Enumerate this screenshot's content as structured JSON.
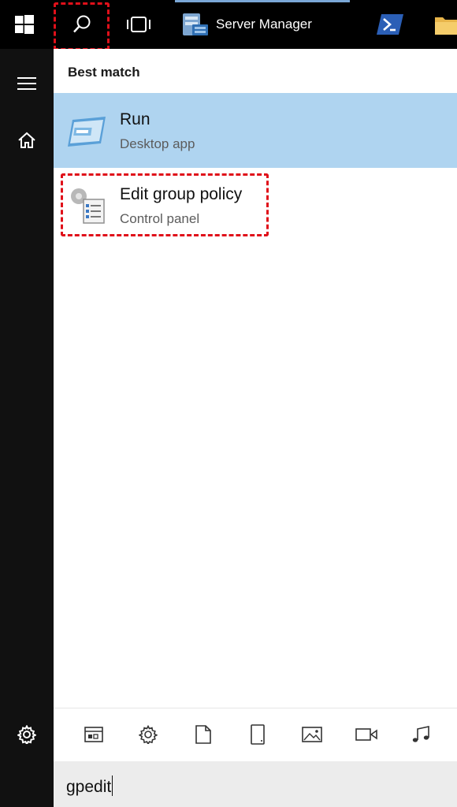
{
  "taskbar": {
    "apps": [
      {
        "label": "Server Manager",
        "icon": "server-manager-icon",
        "active": true
      },
      {
        "label": "",
        "icon": "powershell-icon"
      },
      {
        "label": "",
        "icon": "file-explorer-icon"
      }
    ]
  },
  "panel": {
    "section_title": "Best match",
    "results": [
      {
        "title": "Run",
        "subtitle": "Desktop app",
        "icon": "run-icon",
        "selected": true
      },
      {
        "title": "Edit group policy",
        "subtitle": "Control panel",
        "icon": "group-policy-icon",
        "selected": false
      }
    ]
  },
  "filters": [
    "apps-filter-icon",
    "settings-filter-icon",
    "documents-filter-icon",
    "tablet-filter-icon",
    "photos-filter-icon",
    "videos-filter-icon",
    "music-filter-icon"
  ],
  "search": {
    "value": "gpedit"
  },
  "colors": {
    "selected": "#afd4f0",
    "highlight": "#e0101a",
    "taskbar": "#000000",
    "sidebar": "#111111"
  }
}
